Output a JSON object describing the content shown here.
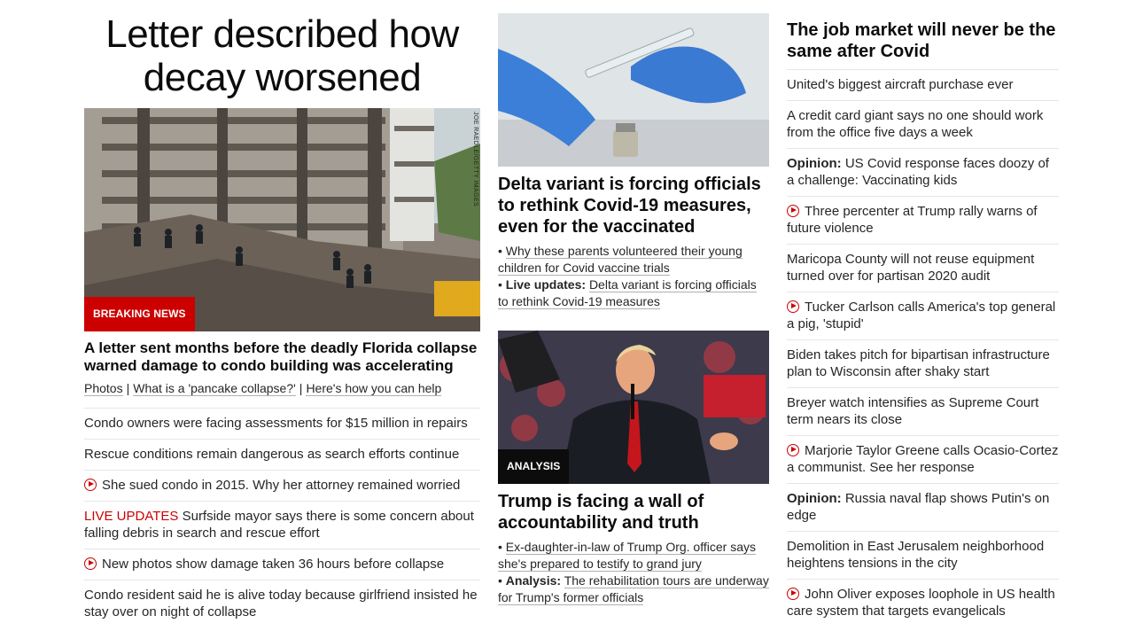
{
  "left": {
    "hero_title": "Letter described how decay worsened",
    "photo_credit": "JOE RAEDLE/GETTY IMAGES",
    "badge": "BREAKING NEWS",
    "headline": "A letter sent months before the deadly Florida collapse warned damage to condo building was accelerating",
    "links": [
      "Photos",
      "What is a 'pancake collapse?'",
      "Here's how you can help"
    ],
    "link_separator": "|",
    "items": [
      {
        "text": "Condo owners were facing assessments for $15 million in repairs"
      },
      {
        "text": "Rescue conditions remain dangerous as search efforts continue"
      },
      {
        "text": "She sued condo in 2015. Why her attorney remained worried",
        "icon": "play-icon"
      },
      {
        "prefix": "LIVE UPDATES",
        "text": "Surfside mayor says there is some concern about falling debris in search and rescue effort"
      },
      {
        "text": "New photos show damage taken 36 hours before collapse",
        "icon": "play-icon"
      },
      {
        "text": "Condo resident said he is alive today because girlfriend insisted he stay over on night of collapse"
      }
    ]
  },
  "middle": {
    "story1": {
      "headline": "Delta variant is forcing officials to rethink Covid-19 measures, even for the vaccinated",
      "bullets": [
        {
          "text": "Why these parents volunteered their young children for Covid vaccine trials"
        },
        {
          "label": "Live updates:",
          "text": "Delta variant is forcing officials to rethink Covid-19 measures"
        }
      ]
    },
    "story2": {
      "badge": "ANALYSIS",
      "headline": "Trump is facing a wall of accountability and truth",
      "bullets": [
        {
          "text": "Ex-daughter-in-law of Trump Org. officer says she's prepared to testify to grand jury"
        },
        {
          "label": "Analysis:",
          "text": "The rehabilitation tours are underway for Trump's former officials"
        }
      ]
    }
  },
  "right": {
    "title": "The job market will never be the same after Covid",
    "items": [
      {
        "text": "United's biggest aircraft purchase ever"
      },
      {
        "text": "A credit card giant says no one should work from the office five days a week"
      },
      {
        "label": "Opinion:",
        "text": "US Covid response faces doozy of a challenge: Vaccinating kids"
      },
      {
        "text": "Three percenter at Trump rally warns of future violence",
        "icon": "play-icon"
      },
      {
        "text": "Maricopa County will not reuse equipment turned over for partisan 2020 audit"
      },
      {
        "text": "Tucker Carlson calls America's top general a pig, 'stupid'",
        "icon": "play-icon"
      },
      {
        "text": "Biden takes pitch for bipartisan infrastructure plan to Wisconsin after shaky start"
      },
      {
        "text": "Breyer watch intensifies as Supreme Court term nears its close"
      },
      {
        "text": "Marjorie Taylor Greene calls Ocasio-Cortez a communist. See her response",
        "icon": "play-icon"
      },
      {
        "label": "Opinion:",
        "text": "Russia naval flap shows Putin's on edge"
      },
      {
        "text": "Demolition in East Jerusalem neighborhood heightens tensions in the city"
      },
      {
        "text": "John Oliver exposes loophole in US health care system that targets evangelicals",
        "icon": "play-icon"
      }
    ]
  },
  "colors": {
    "accent_red": "#cc0000",
    "headline_black": "#0c0c0c",
    "body_text": "#262626",
    "divider": "#e6e6e6"
  }
}
